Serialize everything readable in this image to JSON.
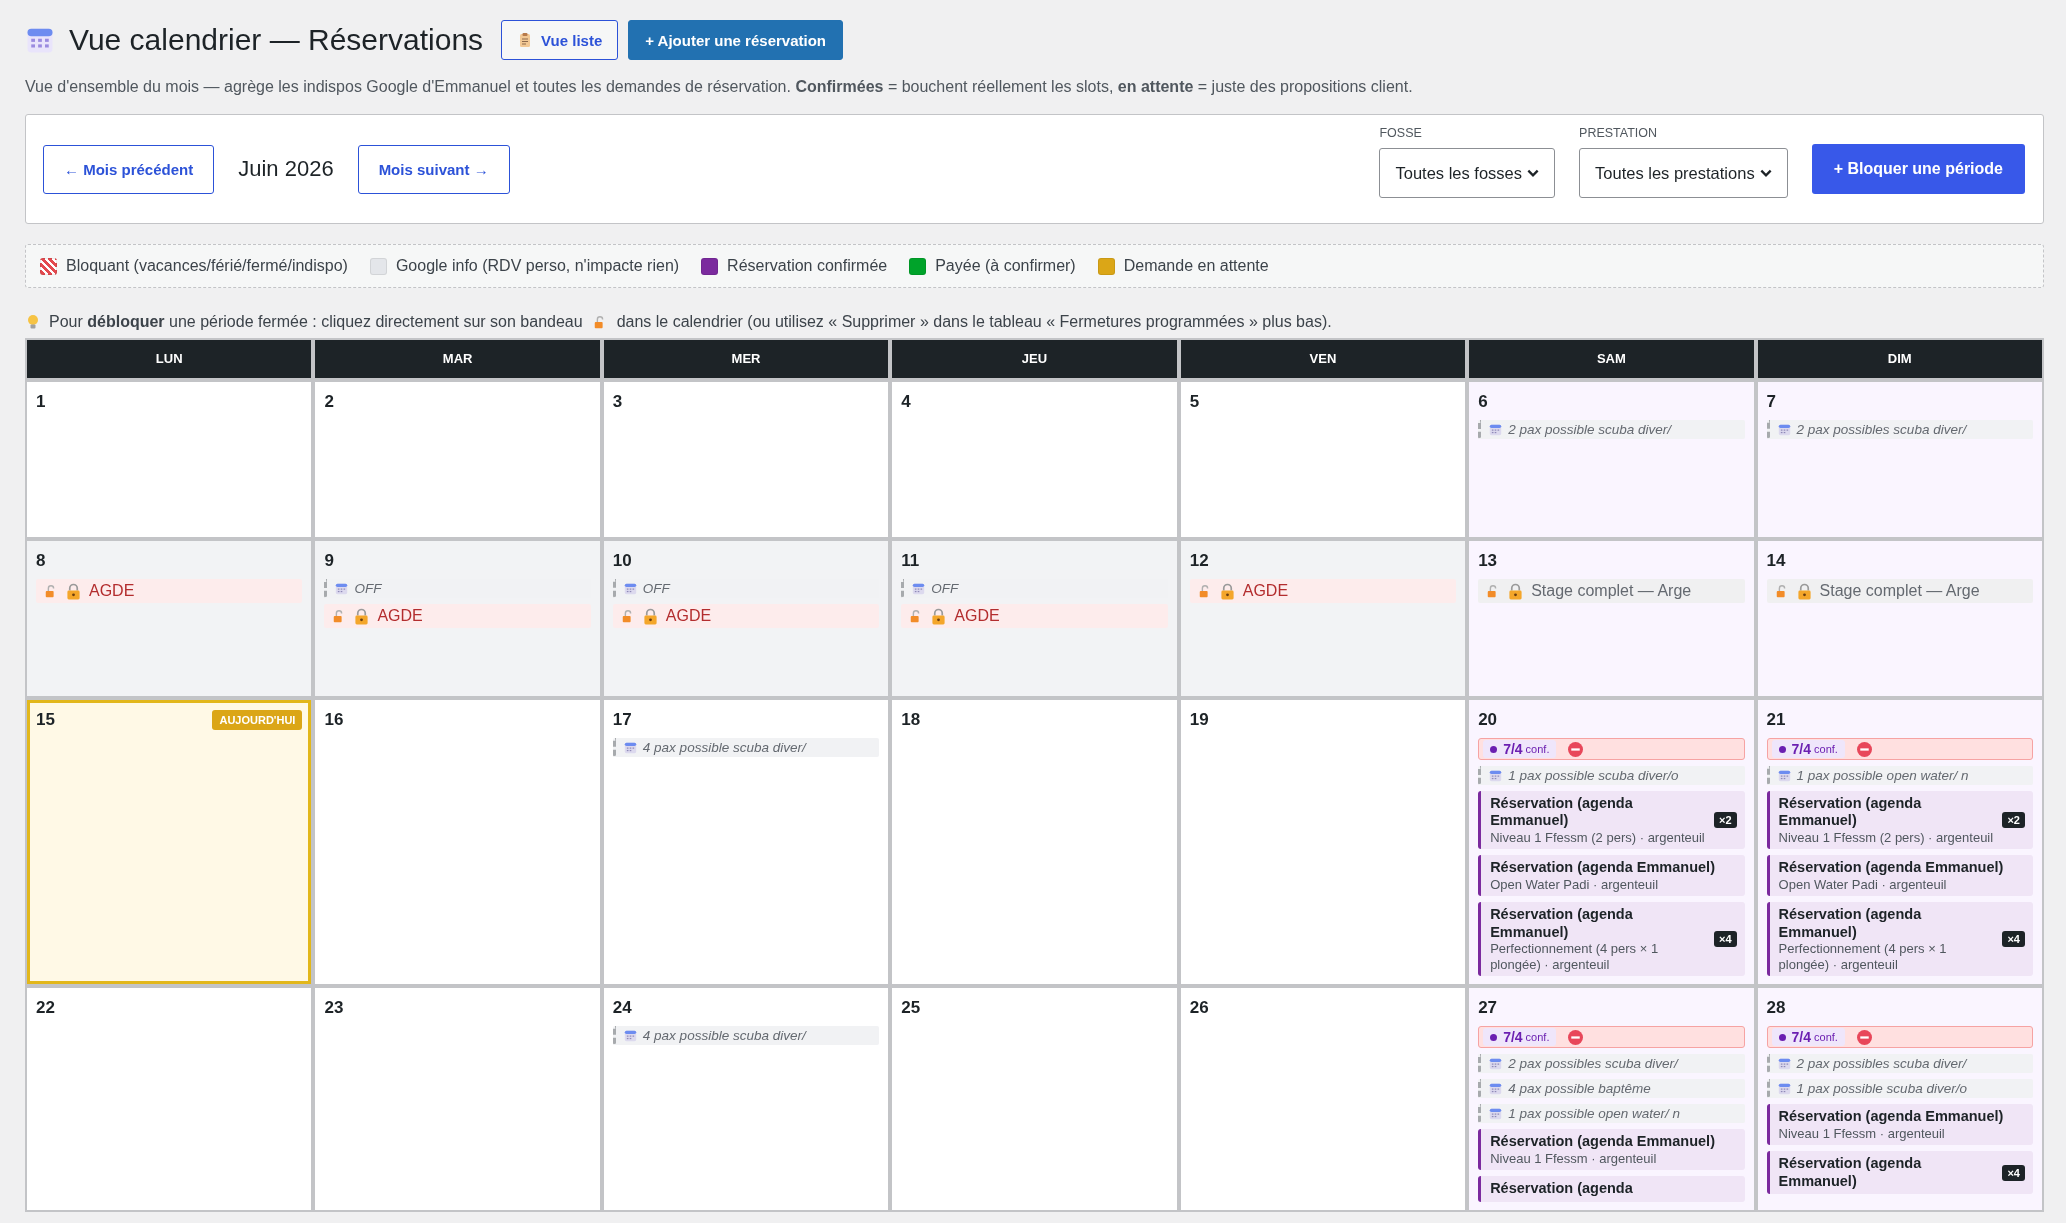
{
  "header": {
    "title": "Vue calendrier — Réservations",
    "list_button": "Vue liste",
    "add_button": "+ Ajouter une réservation"
  },
  "description": "Vue d'ensemble du mois — agrège les indispos Google d'Emmanuel et toutes les demandes de réservation. **Confirmées** = bouchent réellement les slots, **en attente** = juste des propositions client.",
  "toolbar": {
    "prev_button": "← Mois précédent",
    "month": "Juin 2026",
    "next_button": "Mois suivant →",
    "filters": [
      {
        "label": "FOSSE",
        "value": "Toutes les fosses"
      },
      {
        "label": "PRESTATION",
        "value": "Toutes les prestations"
      }
    ],
    "block_button": "+ Bloquer une période"
  },
  "legend": [
    {
      "label": "Bloquant (vacances/férié/fermé/indispo)",
      "kind": "striped",
      "color": "#e34a4f"
    },
    {
      "label": "Google info (RDV perso, n'impacte rien)",
      "kind": "solid",
      "color": "#e4e6ea"
    },
    {
      "label": "Réservation confirmée",
      "kind": "solid",
      "color": "#7b2a9e"
    },
    {
      "label": "Payée (à confirmer)",
      "kind": "solid",
      "color": "#00a32a"
    },
    {
      "label": "Demande en attente",
      "kind": "solid",
      "color": "#dba617"
    }
  ],
  "tip": {
    "before": "Pour **débloquer** une période fermée : cliquez directement sur son bandeau",
    "after": "dans le calendrier (ou utilisez « Supprimer » dans le tableau « Fermetures programmées » plus bas)."
  },
  "weekdays": [
    "LUN",
    "MAR",
    "MER",
    "JEU",
    "VEN",
    "SAM",
    "DIM"
  ],
  "weeks": [
    [
      {
        "number": "1",
        "today": false
      },
      {
        "number": "2",
        "today": false
      },
      {
        "number": "3",
        "today": false
      },
      {
        "number": "4",
        "today": false
      },
      {
        "number": "5",
        "today": false
      },
      {
        "number": "6",
        "today": false,
        "events": [
          {
            "kind": "google",
            "text": "2 pax possible scuba diver/"
          }
        ]
      },
      {
        "number": "7",
        "today": false,
        "events": [
          {
            "kind": "google",
            "text": "2 pax possibles scuba diver/"
          }
        ]
      }
    ],
    [
      {
        "number": "8",
        "today": false,
        "events": [
          {
            "kind": "block",
            "closed": true,
            "text": "AGDE"
          }
        ]
      },
      {
        "number": "9",
        "today": false,
        "events": [
          {
            "kind": "google",
            "text": "OFF"
          },
          {
            "kind": "block",
            "closed": true,
            "text": "AGDE"
          }
        ]
      },
      {
        "number": "10",
        "today": false,
        "events": [
          {
            "kind": "google",
            "text": "OFF"
          },
          {
            "kind": "block",
            "closed": true,
            "text": "AGDE"
          }
        ]
      },
      {
        "number": "11",
        "today": false,
        "events": [
          {
            "kind": "google",
            "text": "OFF"
          },
          {
            "kind": "block",
            "closed": true,
            "text": "AGDE"
          }
        ]
      },
      {
        "number": "12",
        "today": false,
        "events": [
          {
            "kind": "block",
            "closed": true,
            "text": "AGDE"
          }
        ]
      },
      {
        "number": "13",
        "today": false,
        "events": [
          {
            "kind": "block",
            "closed": false,
            "text": "Stage complet — Arge"
          }
        ]
      },
      {
        "number": "14",
        "today": false,
        "events": [
          {
            "kind": "block",
            "closed": false,
            "text": "Stage complet — Arge"
          }
        ]
      }
    ],
    [
      {
        "number": "15",
        "today": true,
        "badge": "AUJOURD'HUI"
      },
      {
        "number": "16",
        "today": false
      },
      {
        "number": "17",
        "today": false,
        "events": [
          {
            "kind": "google",
            "text": "4 pax possible scuba diver/"
          }
        ]
      },
      {
        "number": "18",
        "today": false
      },
      {
        "number": "19",
        "today": false
      },
      {
        "number": "20",
        "today": false,
        "events": [
          {
            "kind": "capacity",
            "count": "7/4",
            "unit": "conf."
          },
          {
            "kind": "google",
            "text": "1 pax possible scuba diver/o"
          },
          {
            "kind": "booking",
            "title": "Réservation (agenda Emmanuel)",
            "detail": "Niveau 1 Ffessm (2 pers) · argenteuil",
            "badge": "×2"
          },
          {
            "kind": "booking",
            "title": "Réservation (agenda Emmanuel)",
            "detail": "Open Water Padi · argenteuil"
          },
          {
            "kind": "booking",
            "title": "Réservation (agenda Emmanuel)",
            "detail": "Perfectionnement (4 pers × 1 plongée) · argenteuil",
            "badge": "×4"
          }
        ]
      },
      {
        "number": "21",
        "today": false,
        "events": [
          {
            "kind": "capacity",
            "count": "7/4",
            "unit": "conf."
          },
          {
            "kind": "google",
            "text": "1 pax possible open water/ n"
          },
          {
            "kind": "booking",
            "title": "Réservation (agenda Emmanuel)",
            "detail": "Niveau 1 Ffessm (2 pers) · argenteuil",
            "badge": "×2"
          },
          {
            "kind": "booking",
            "title": "Réservation (agenda Emmanuel)",
            "detail": "Open Water Padi · argenteuil"
          },
          {
            "kind": "booking",
            "title": "Réservation (agenda Emmanuel)",
            "detail": "Perfectionnement (4 pers × 1 plongée) · argenteuil",
            "badge": "×4"
          }
        ]
      }
    ],
    [
      {
        "number": "22",
        "today": false
      },
      {
        "number": "23",
        "today": false
      },
      {
        "number": "24",
        "today": false,
        "events": [
          {
            "kind": "google",
            "text": "4 pax possible scuba diver/"
          }
        ]
      },
      {
        "number": "25",
        "today": false
      },
      {
        "number": "26",
        "today": false
      },
      {
        "number": "27",
        "today": false,
        "events": [
          {
            "kind": "capacity",
            "count": "7/4",
            "unit": "conf."
          },
          {
            "kind": "google",
            "text": "2 pax possibles scuba diver/"
          },
          {
            "kind": "google",
            "text": "4 pax possible baptême"
          },
          {
            "kind": "google",
            "text": "1 pax possible open water/ n"
          },
          {
            "kind": "booking",
            "title": "Réservation (agenda Emmanuel)",
            "detail": "Niveau 1 Ffessm · argenteuil"
          },
          {
            "kind": "booking",
            "title": "Réservation (agenda"
          }
        ]
      },
      {
        "number": "28",
        "today": false,
        "events": [
          {
            "kind": "capacity",
            "count": "7/4",
            "unit": "conf."
          },
          {
            "kind": "google",
            "text": "2 pax possibles scuba diver/"
          },
          {
            "kind": "google",
            "text": "1 pax possible scuba diver/o"
          },
          {
            "kind": "booking",
            "title": "Réservation (agenda Emmanuel)",
            "detail": "Niveau 1 Ffessm · argenteuil"
          },
          {
            "kind": "booking",
            "title": "Réservation (agenda Emmanuel)",
            "badge": "×4"
          }
        ]
      }
    ]
  ]
}
